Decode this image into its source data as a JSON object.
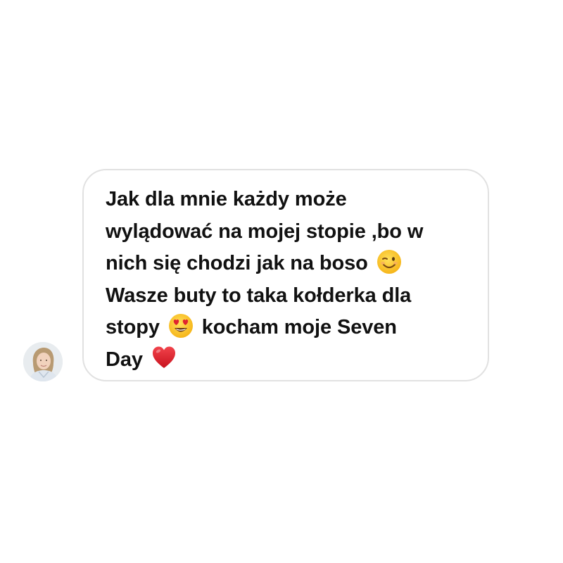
{
  "message": {
    "lines": [
      {
        "text": "Jak dla mnie każdy może",
        "emoji": null,
        "after": ""
      },
      {
        "text": "wylądować na mojej stopie ,bo w",
        "emoji": null,
        "after": ""
      },
      {
        "text": "nich się chodzi jak na boso",
        "emoji": "winking-face-icon",
        "after": ""
      },
      {
        "text": "Wasze buty to taka kołderka dla",
        "emoji": null,
        "after": ""
      },
      {
        "text": "stopy",
        "emoji": "heart-eyes-face-icon",
        "after": "kocham moje Seven"
      },
      {
        "text": "Day",
        "emoji": "red-heart-icon",
        "after": ""
      }
    ]
  },
  "colors": {
    "bubble_border": "#e1e1e1",
    "text": "#111111",
    "background": "#ffffff",
    "emoji_face": "#fcc21b",
    "heart": "#e0242f"
  }
}
